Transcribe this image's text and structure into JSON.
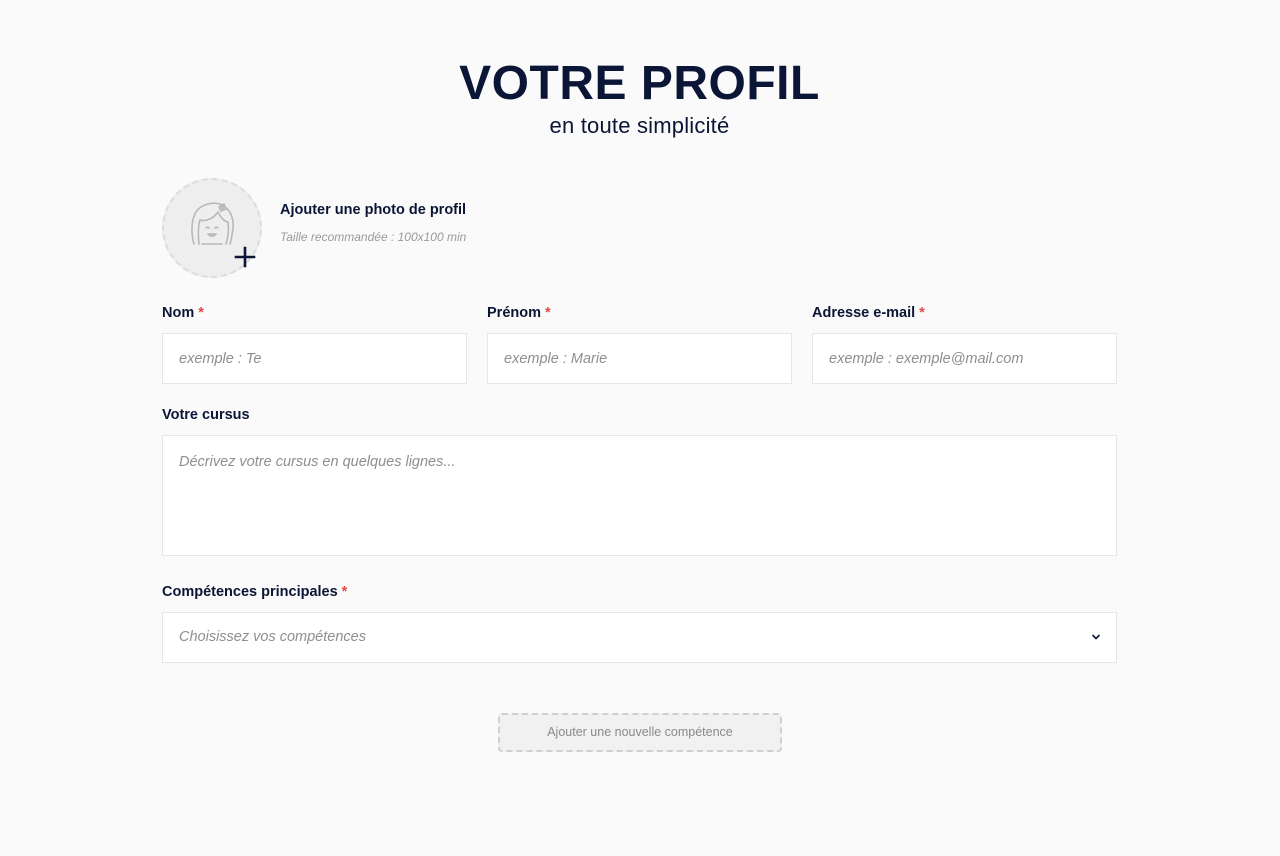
{
  "header": {
    "title": "VOTRE PROFIL",
    "subtitle": "en toute simplicité"
  },
  "photo": {
    "title": "Ajouter une photo de profil",
    "hint": "Taille recommandée : 100x100 min",
    "avatar_icon": "girl-face-icon",
    "add_icon": "plus-icon"
  },
  "form": {
    "required_mark": "*",
    "nom": {
      "label": "Nom",
      "placeholder": "exemple : Te",
      "value": ""
    },
    "prenom": {
      "label": "Prénom",
      "placeholder": "exemple : Marie",
      "value": ""
    },
    "email": {
      "label": "Adresse e-mail",
      "placeholder": "exemple : exemple@mail.com",
      "value": ""
    },
    "cursus": {
      "label": "Votre cursus",
      "placeholder": "Décrivez votre cursus en quelques lignes...",
      "value": ""
    },
    "competences": {
      "label": "Compétences principales",
      "placeholder": "Choisissez vos compétences",
      "icon": "chevron-down-icon"
    }
  },
  "actions": {
    "add_skill_label": "Ajouter une nouvelle compétence"
  },
  "colors": {
    "text": "#0b1535",
    "required": "#e04848",
    "placeholder": "#8e8e8e",
    "border": "#e6e6e6",
    "background": "#fafafa"
  }
}
